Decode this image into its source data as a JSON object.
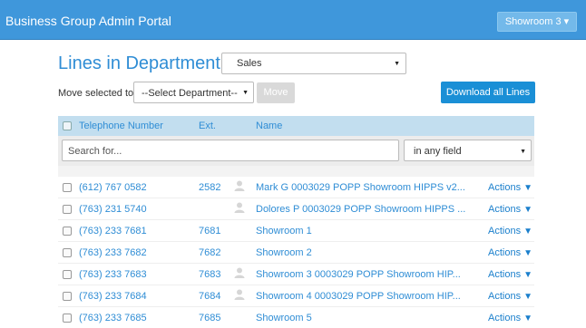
{
  "header": {
    "title": "Business Group Admin Portal",
    "showroom_label": "Showroom 3",
    "showroom_caret": "▾"
  },
  "page": {
    "title": "Lines in Department:",
    "department_selected": "Sales"
  },
  "toolbar": {
    "move_label": "Move selected to:",
    "move_select_value": "--Select Department--",
    "move_button": "Move",
    "download_button": "Download all Lines"
  },
  "table": {
    "columns": [
      "Telephone Number",
      "Ext.",
      "Name"
    ],
    "search_placeholder": "Search for...",
    "filter_value": "in any field",
    "rows": [
      {
        "tel": "(612) 767 0582",
        "ext": "2582",
        "icon": "person-icon",
        "name": "Mark G 0003029 POPP Showroom HIPPS v2...",
        "action": "Actions"
      },
      {
        "tel": "(763) 231 5740",
        "ext": "",
        "icon": "person-icon",
        "name": "Dolores P 0003029 POPP Showroom HIPPS ...",
        "action": "Actions"
      },
      {
        "tel": "(763) 233 7681",
        "ext": "7681",
        "icon": "",
        "name": "Showroom 1",
        "action": "Actions"
      },
      {
        "tel": "(763) 233 7682",
        "ext": "7682",
        "icon": "",
        "name": "Showroom 2",
        "action": "Actions"
      },
      {
        "tel": "(763) 233 7683",
        "ext": "7683",
        "icon": "person-icon",
        "name": "Showroom 3 0003029 POPP Showroom HIP...",
        "action": "Actions"
      },
      {
        "tel": "(763) 233 7684",
        "ext": "7684",
        "icon": "person-icon",
        "name": "Showroom 4 0003029 POPP Showroom HIP...",
        "action": "Actions"
      },
      {
        "tel": "(763) 233 7685",
        "ext": "7685",
        "icon": "",
        "name": "Showroom 5",
        "action": "Actions"
      }
    ]
  },
  "colors": {
    "topbar": "#3f97db",
    "accent": "#2f8dd5",
    "header_row": "#c2deef"
  }
}
